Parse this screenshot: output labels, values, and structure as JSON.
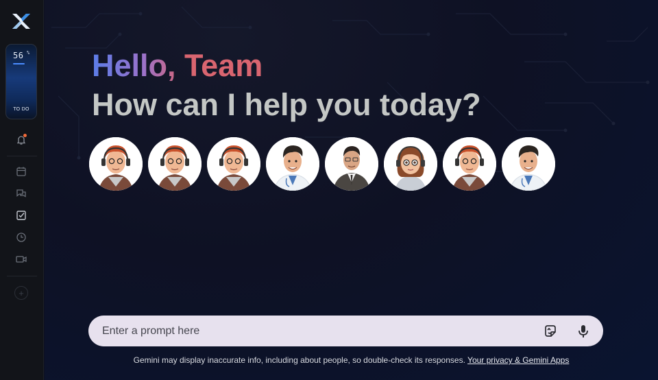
{
  "sidebar": {
    "logo": "app-logo-icon",
    "widget": {
      "value": "56",
      "unit": "%",
      "label": "TO DO",
      "progress": 0.56
    },
    "icons": [
      "bell-icon",
      "calendar-icon",
      "chat-icon",
      "checkbox-icon",
      "clock-icon",
      "video-icon",
      "plus-icon"
    ],
    "add_label": "+"
  },
  "main": {
    "greeting": "Hello, Team",
    "subhead": "How can I help you today?",
    "avatars": [
      {
        "name": "avatar-redhead-headset-1"
      },
      {
        "name": "avatar-redhead-headset-2"
      },
      {
        "name": "avatar-redhead-headset-3"
      },
      {
        "name": "avatar-doctor-1"
      },
      {
        "name": "avatar-businessman"
      },
      {
        "name": "avatar-woman-headset"
      },
      {
        "name": "avatar-redhead-headset-4"
      },
      {
        "name": "avatar-doctor-2"
      }
    ]
  },
  "prompt": {
    "placeholder": "Enter a prompt here",
    "image_icon": "image-upload-icon",
    "mic_icon": "microphone-icon"
  },
  "footer": {
    "disclaimer": "Gemini may display inaccurate info, including about people, so double-check its responses.",
    "link": "Your privacy & Gemini Apps"
  },
  "colors": {
    "accent_blue": "#5b7de8",
    "accent_pink": "#d96570",
    "prompt_bg": "#e7e1ee",
    "notification": "#f26b3a"
  }
}
